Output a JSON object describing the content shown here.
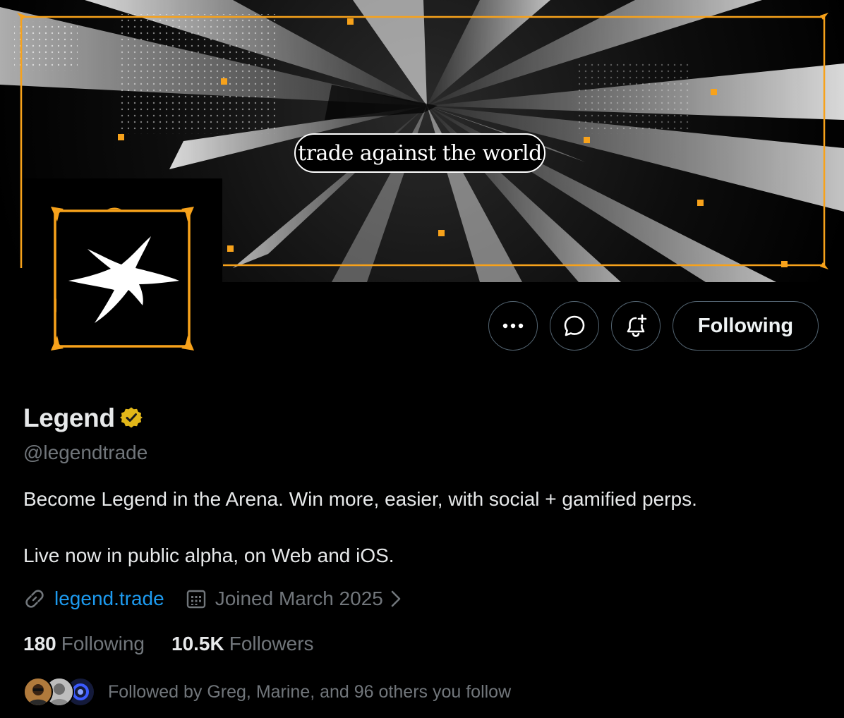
{
  "banner": {
    "tagline": "trade against the world",
    "accent_color": "#f7a21b"
  },
  "profile": {
    "display_name": "Legend",
    "verified_badge": "verified-gold-badge-icon",
    "handle": "@legendtrade",
    "bio_line_1": "Become Legend in the Arena. Win more, easier, with social + gamified perps.",
    "bio_line_2": "Live now in public alpha, on Web and iOS.",
    "website": "legend.trade",
    "joined": "Joined March 2025"
  },
  "actions": {
    "more_icon": "more-dots-icon",
    "message_icon": "message-icon",
    "notify_icon": "notification-bell-plus-icon",
    "follow_state_label": "Following"
  },
  "stats": {
    "following_count": "180",
    "following_label": "Following",
    "followers_count": "10.5K",
    "followers_label": "Followers"
  },
  "followed_by": {
    "text": "Followed by Greg, Marine, and 96 others you follow"
  },
  "colors": {
    "background": "#000000",
    "text_primary": "#e7e9ea",
    "text_secondary": "#71767b",
    "link": "#1d9bf0",
    "verified_gold": "#e2b719"
  }
}
